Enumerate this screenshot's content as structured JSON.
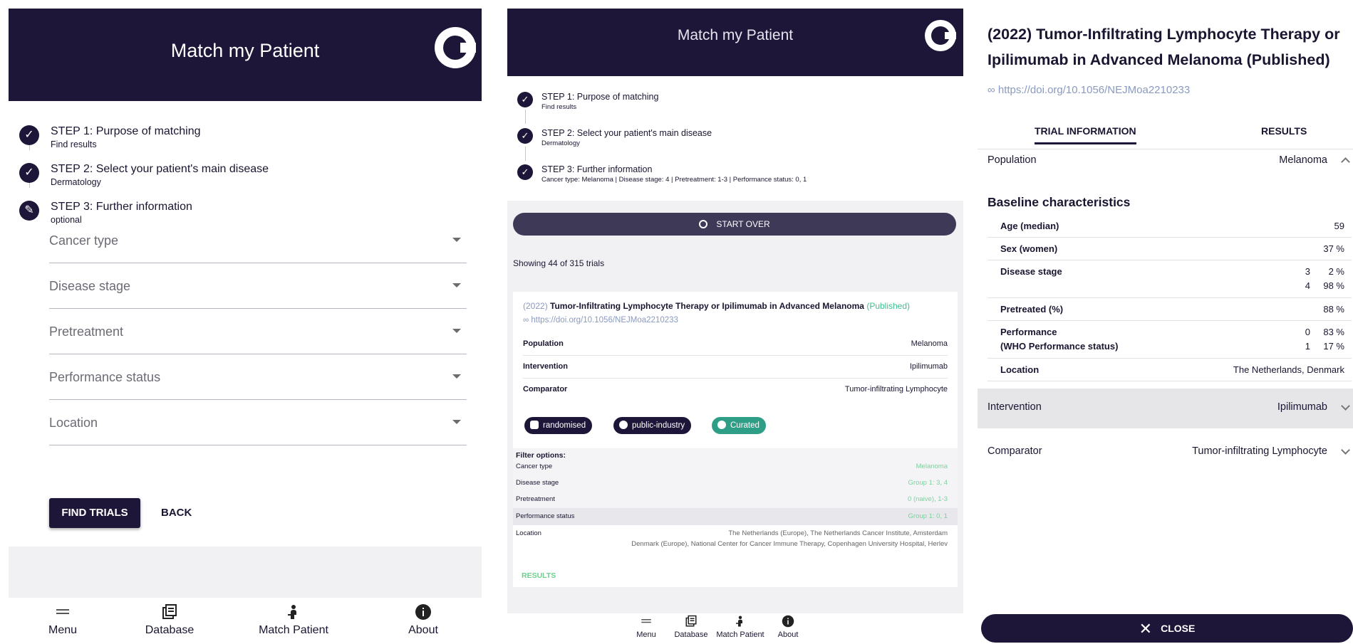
{
  "app_title": "Match my Patient",
  "steps": [
    {
      "title": "STEP 1: Purpose of matching",
      "sub": "Find results"
    },
    {
      "title": "STEP 2: Select your patient's main disease",
      "sub": "Dermatology"
    },
    {
      "title": "STEP 3: Further information",
      "sub": "optional"
    }
  ],
  "step3_summary": "Cancer type: Melanoma | Disease stage: 4 | Pretreatment: 1-3 | Performance status: 0, 1",
  "filters": [
    "Cancer type",
    "Disease stage",
    "Pretreatment",
    "Performance status",
    "Location"
  ],
  "buttons": {
    "find": "FIND TRIALS",
    "back": "BACK",
    "start_over": "START OVER",
    "close": "CLOSE"
  },
  "nav": [
    "Menu",
    "Database",
    "Match Patient",
    "About"
  ],
  "results": {
    "showing": "Showing 44 of 315 trials"
  },
  "trial": {
    "year": "(2022)",
    "name": "Tumor-Infiltrating Lymphocyte Therapy or Ipilimumab in Advanced Melanoma",
    "status": "(Published)",
    "full_title": "(2022) Tumor-Infiltrating Lymphocyte Therapy or Ipilimumab in Advanced Melanoma (Published)",
    "doi": "∞ https://doi.org/10.1056/NEJMoa2210233",
    "rows": [
      {
        "k": "Population",
        "v": "Melanoma"
      },
      {
        "k": "Intervention",
        "v": "Ipilimumab"
      },
      {
        "k": "Comparator",
        "v": "Tumor-infiltrating Lymphocyte"
      }
    ],
    "chips": [
      "randomised",
      "public-industry",
      "Curated"
    ],
    "results_link": "RESULTS"
  },
  "filter_options": {
    "heading": "Filter options:",
    "rows": [
      {
        "k": "Cancer type",
        "v": "Melanoma"
      },
      {
        "k": "Disease stage",
        "v": "Group 1: 3, 4"
      },
      {
        "k": "Pretreatment",
        "v": "0 (naive), 1-3"
      },
      {
        "k": "Performance status",
        "v": "Group 1: 0, 1"
      }
    ],
    "location_label": "Location",
    "location_lines": [
      "The Netherlands (Europe), The Netherlands Cancer Institute, Amsterdam",
      "Denmark (Europe), National Center for Cancer Immune Therapy, Copenhagen University Hospital, Herlev"
    ]
  },
  "detail": {
    "tabs": [
      "TRIAL INFORMATION",
      "RESULTS"
    ],
    "population_label": "Population",
    "population_value": "Melanoma",
    "baseline_title": "Baseline characteristics",
    "baseline": [
      {
        "k": "Age (median)",
        "p": "59"
      },
      {
        "k": "Sex (women)",
        "p": "37 %"
      },
      {
        "k": "Disease stage",
        "n1": "3",
        "p1": "2 %",
        "n2": "4",
        "p2": "98 %"
      },
      {
        "k": "Pretreated (%)",
        "p": "88 %"
      },
      {
        "k": "Performance",
        "k2": "(WHO Performance status)",
        "n1": "0",
        "p1": "83 %",
        "n2": "1",
        "p2": "17 %"
      },
      {
        "k": "Location",
        "p": "The Netherlands, Denmark"
      }
    ],
    "intervention_label": "Intervention",
    "intervention_value": "Ipilimumab",
    "comparator_label": "Comparator",
    "comparator_value": "Tumor-infiltrating Lymphocyte"
  },
  "colors": {
    "primary": "#1d1638",
    "published": "#3fbf8e",
    "curated": "#2f9e86",
    "doi": "#8a9ac0"
  }
}
